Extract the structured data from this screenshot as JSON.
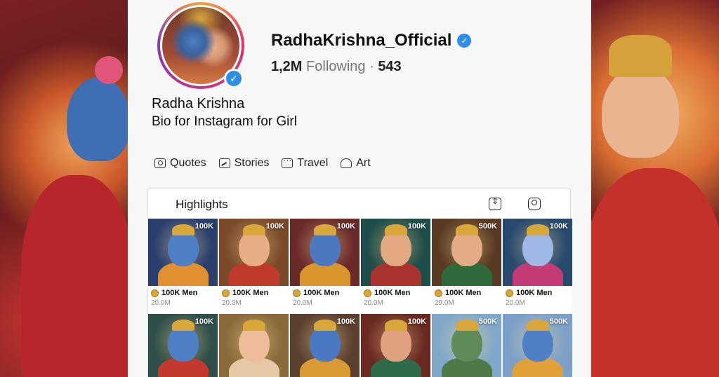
{
  "profile": {
    "username": "RadhaKrishna_Official",
    "followers": "1,2M",
    "following_label": "Following",
    "separator": "·",
    "following_count": "543",
    "display_name": "Radha Krishna",
    "bio": "Bio for Instagram for Girl"
  },
  "tags": [
    {
      "label": "Quotes",
      "icon": "camera-icon"
    },
    {
      "label": "Stories",
      "icon": "story-icon"
    },
    {
      "label": "Travel",
      "icon": "travel-icon"
    },
    {
      "label": "Art",
      "icon": "person-icon"
    }
  ],
  "highlights": {
    "title": "Highlights",
    "row1": [
      {
        "badge": "100K",
        "label": "100K Men",
        "sub": "20.0M",
        "fig": "#4f7fc4",
        "bg": "#2a3f6e",
        "body": "#e0902e"
      },
      {
        "badge": "100K",
        "label": "100K Men",
        "sub": "20.0M",
        "fig": "#e6ad86",
        "bg": "#7a4a2a",
        "body": "#c03a2b"
      },
      {
        "badge": "100K",
        "label": "100K Men",
        "sub": "20.0M",
        "fig": "#4d78c0",
        "bg": "#6a2a2a",
        "body": "#d9962f"
      },
      {
        "badge": "100K",
        "label": "100K Men",
        "sub": "20.0M",
        "fig": "#e2a982",
        "bg": "#1f4d4a",
        "body": "#a8342d"
      },
      {
        "badge": "500K",
        "label": "100K Men",
        "sub": "29.0M",
        "fig": "#e4ac86",
        "bg": "#5a3a22",
        "body": "#2f6b3a"
      },
      {
        "badge": "100K",
        "label": "100K Men",
        "sub": "20.0M",
        "fig": "#9fb8e6",
        "bg": "#274a6e",
        "body": "#c43a74"
      }
    ],
    "row2": [
      {
        "badge": "100K",
        "fig": "#4f7fc4",
        "bg": "#2f4f4a",
        "body": "#c23a2e"
      },
      {
        "badge": "",
        "fig": "#ecbd98",
        "bg": "#8a6a3a",
        "body": "#e6c7a6"
      },
      {
        "badge": "100K",
        "fig": "#4a78c2",
        "bg": "#5b4030",
        "body": "#d99a33"
      },
      {
        "badge": "100K",
        "fig": "#e0a27e",
        "bg": "#6a2a22",
        "body": "#2f6b4a"
      },
      {
        "badge": "500K",
        "fig": "#5f8a5a",
        "bg": "#7fa8c8",
        "body": "#4d7a46"
      },
      {
        "badge": "500K",
        "fig": "#4f7fc4",
        "bg": "#7ca0c8",
        "body": "#e0a03a"
      }
    ]
  }
}
